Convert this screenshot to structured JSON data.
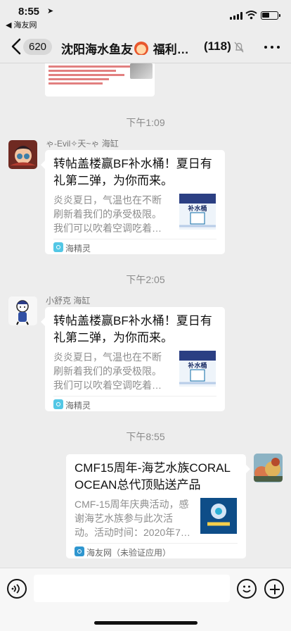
{
  "status_bar": {
    "time": "8:55",
    "back_app": "◀ 海友网"
  },
  "nav": {
    "unread_count": "620",
    "title_left": "沈阳海水鱼友",
    "title_right": "福利…",
    "member_count": "(118)"
  },
  "messages": [
    {
      "time": "下午1:09",
      "sender": "ゃ-Evil✧天~ゃ 海缸",
      "title": "转帖盖楼赢BF补水桶！夏日有礼第二弹，为你而来。",
      "description": "炎炎夏日，气温也在不断刷新着我们的承受极限。我们可以吹着空调吃着…",
      "thumbnail_label": "补水桶",
      "source": "海精灵"
    },
    {
      "time": "下午2:05",
      "sender": "小舒克 海缸",
      "title": "转帖盖楼赢BF补水桶！夏日有礼第二弹，为你而来。",
      "description": "炎炎夏日，气温也在不断刷新着我们的承受极限。我们可以吹着空调吃着…",
      "thumbnail_label": "补水桶",
      "source": "海精灵"
    },
    {
      "time": "下午8:55",
      "title": "CMF15周年-海艺水族CORAL OCEAN总代顶贴送产品",
      "description": "CMF-15周年庆典活动，感谢海艺水族参与此次活动。活动时间：2020年7…",
      "source": "海友网（未验证应用）"
    }
  ],
  "icons": {
    "location": "location-arrow-icon",
    "back": "chevron-left-icon",
    "mute": "bell-slash-icon",
    "more": "more-icon",
    "voice": "voice-icon",
    "emoji": "emoji-icon",
    "add": "add-icon"
  },
  "colors": {
    "background": "#ededed",
    "card": "#ffffff",
    "muted_text": "#8d8d8d"
  }
}
